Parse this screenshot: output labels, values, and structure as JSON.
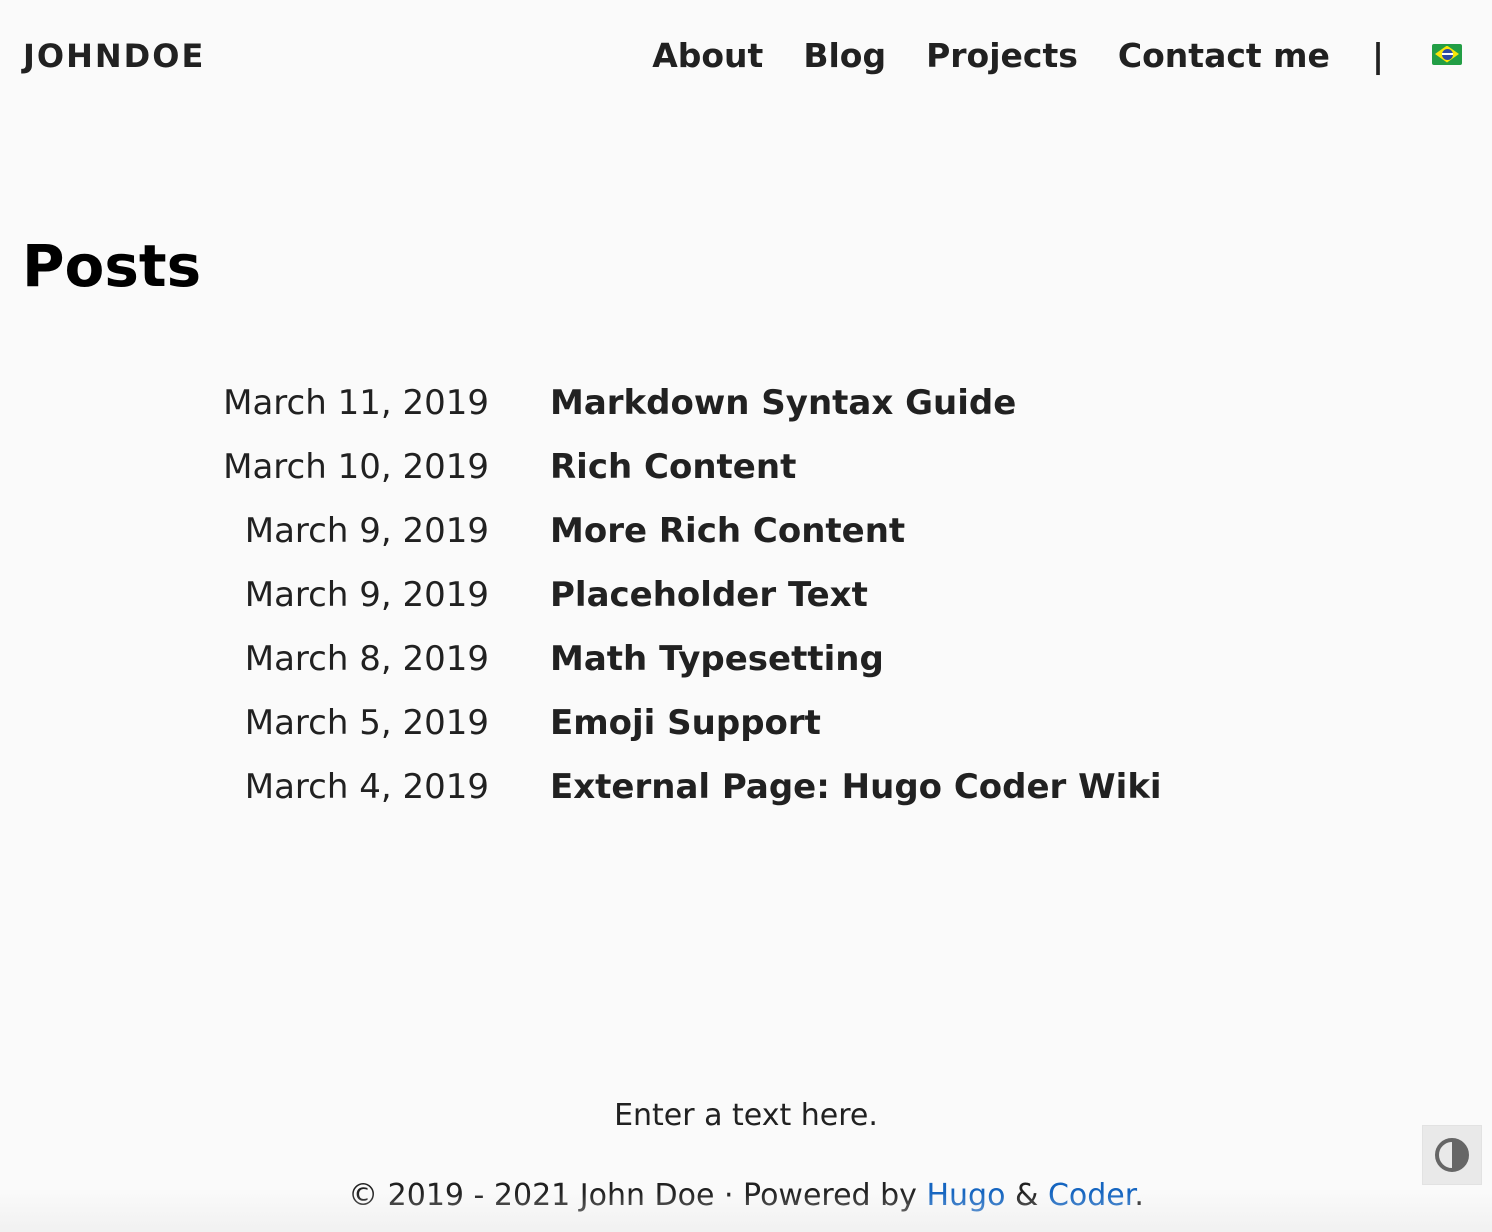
{
  "header": {
    "brand": "JOHNDOE",
    "nav": [
      {
        "label": "About"
      },
      {
        "label": "Blog"
      },
      {
        "label": "Projects"
      },
      {
        "label": "Contact me"
      }
    ],
    "separator": "|",
    "language_icon": "brazil-flag-icon"
  },
  "main": {
    "title": "Posts",
    "posts": [
      {
        "date": "March 11, 2019",
        "title": "Markdown Syntax Guide"
      },
      {
        "date": "March 10, 2019",
        "title": "Rich Content"
      },
      {
        "date": "March 9, 2019",
        "title": "More Rich Content"
      },
      {
        "date": "March 9, 2019",
        "title": "Placeholder Text"
      },
      {
        "date": "March 8, 2019",
        "title": "Math Typesetting"
      },
      {
        "date": "March 5, 2019",
        "title": "Emoji Support"
      },
      {
        "date": "March 4, 2019",
        "title": "External Page: Hugo Coder Wiki"
      }
    ]
  },
  "footer": {
    "text": "Enter a text here.",
    "copyright": "© 2019 - 2021 John Doe · Powered by ",
    "hugo_label": "Hugo",
    "ampersand": " & ",
    "coder_label": "Coder",
    "period": ".",
    "link_color": "#1565c0"
  },
  "theme_toggle": {
    "icon": "contrast-icon"
  },
  "colors": {
    "background": "#fafafa",
    "text": "#212121",
    "link": "#1565c0"
  }
}
